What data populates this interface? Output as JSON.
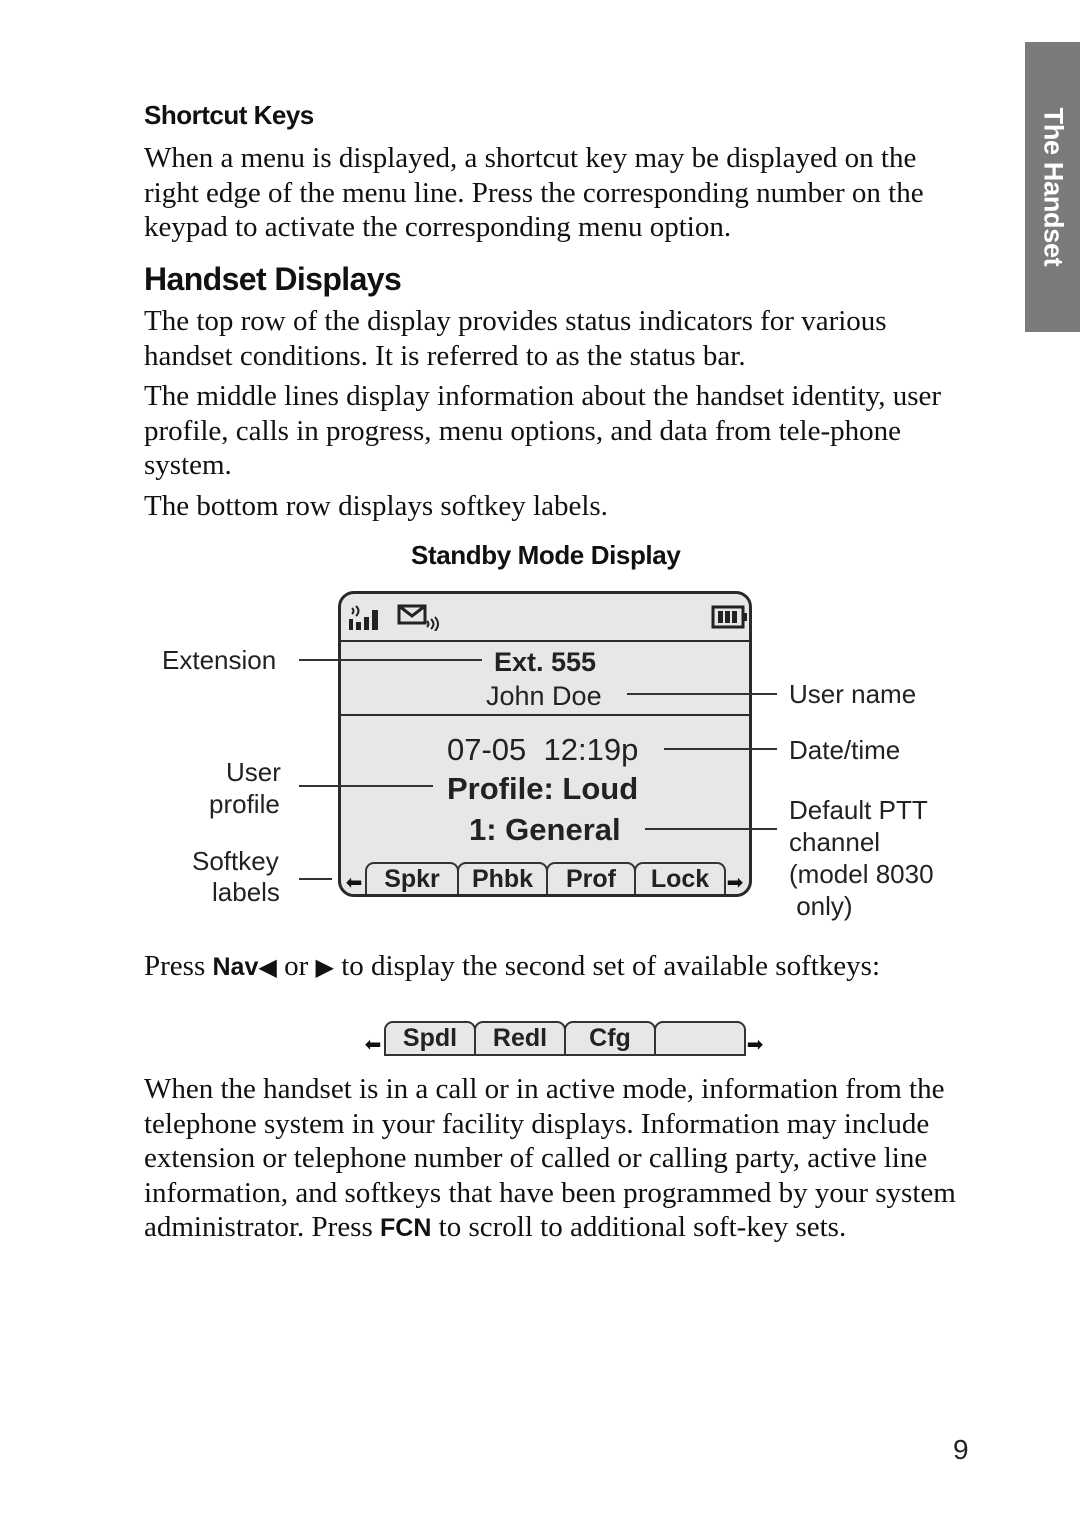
{
  "side_tab": {
    "label": "The Handset"
  },
  "shortcut_keys": {
    "heading": "Shortcut Keys",
    "body": "When a menu is displayed, a shortcut key may be displayed on the right edge of the menu line. Press the corresponding number on the keypad to activate the corresponding menu option."
  },
  "handset_displays": {
    "heading": "Handset Displays",
    "paragraphs": [
      "The top row of the display provides status indicators for various handset conditions. It is referred to as the status bar.",
      "The middle lines display information about the handset identity, user profile, calls in progress, menu options, and data from tele-phone system.",
      "The bottom row displays softkey labels."
    ]
  },
  "figure": {
    "title": "Standby Mode Display",
    "status_icons": [
      "signal-strength-icon",
      "voicemail-message-icon",
      "battery-icon"
    ],
    "extension": "Ext. 555",
    "user_name": "John Doe",
    "datetime": "07-05  12:19p",
    "profile": "Profile: Loud",
    "ptt_channel": "1: General",
    "softkeys": [
      "Spkr",
      "Phbk",
      "Prof",
      "Lock"
    ],
    "callouts": {
      "extension": "Extension",
      "user_profile_1": "User",
      "user_profile_2": "profile",
      "softkey_labels_1": "Softkey",
      "softkey_labels_2": "labels",
      "user_name": "User name",
      "datetime": "Date/time",
      "ptt_1": "Default PTT",
      "ptt_2": "channel",
      "ptt_3": "(model 8030",
      "ptt_4": " only)"
    }
  },
  "nav_instruction": {
    "pre": "Press ",
    "key": "Nav",
    "left_glyph": "◀",
    "mid": " or ",
    "right_glyph": "▶",
    "post": " to display the second set of available softkeys:"
  },
  "second_softkeys": [
    "Spdl",
    "Redl",
    "Cfg",
    ""
  ],
  "active_mode": {
    "pre": "When the handset is in a call or in active mode, information from the telephone system in your facility displays. Information may include extension or telephone number of called or calling party, active line information, and softkeys that have been programmed by your system administrator. Press ",
    "key": "FCN",
    "post": " to scroll to additional soft-key sets."
  },
  "page_number": "9"
}
